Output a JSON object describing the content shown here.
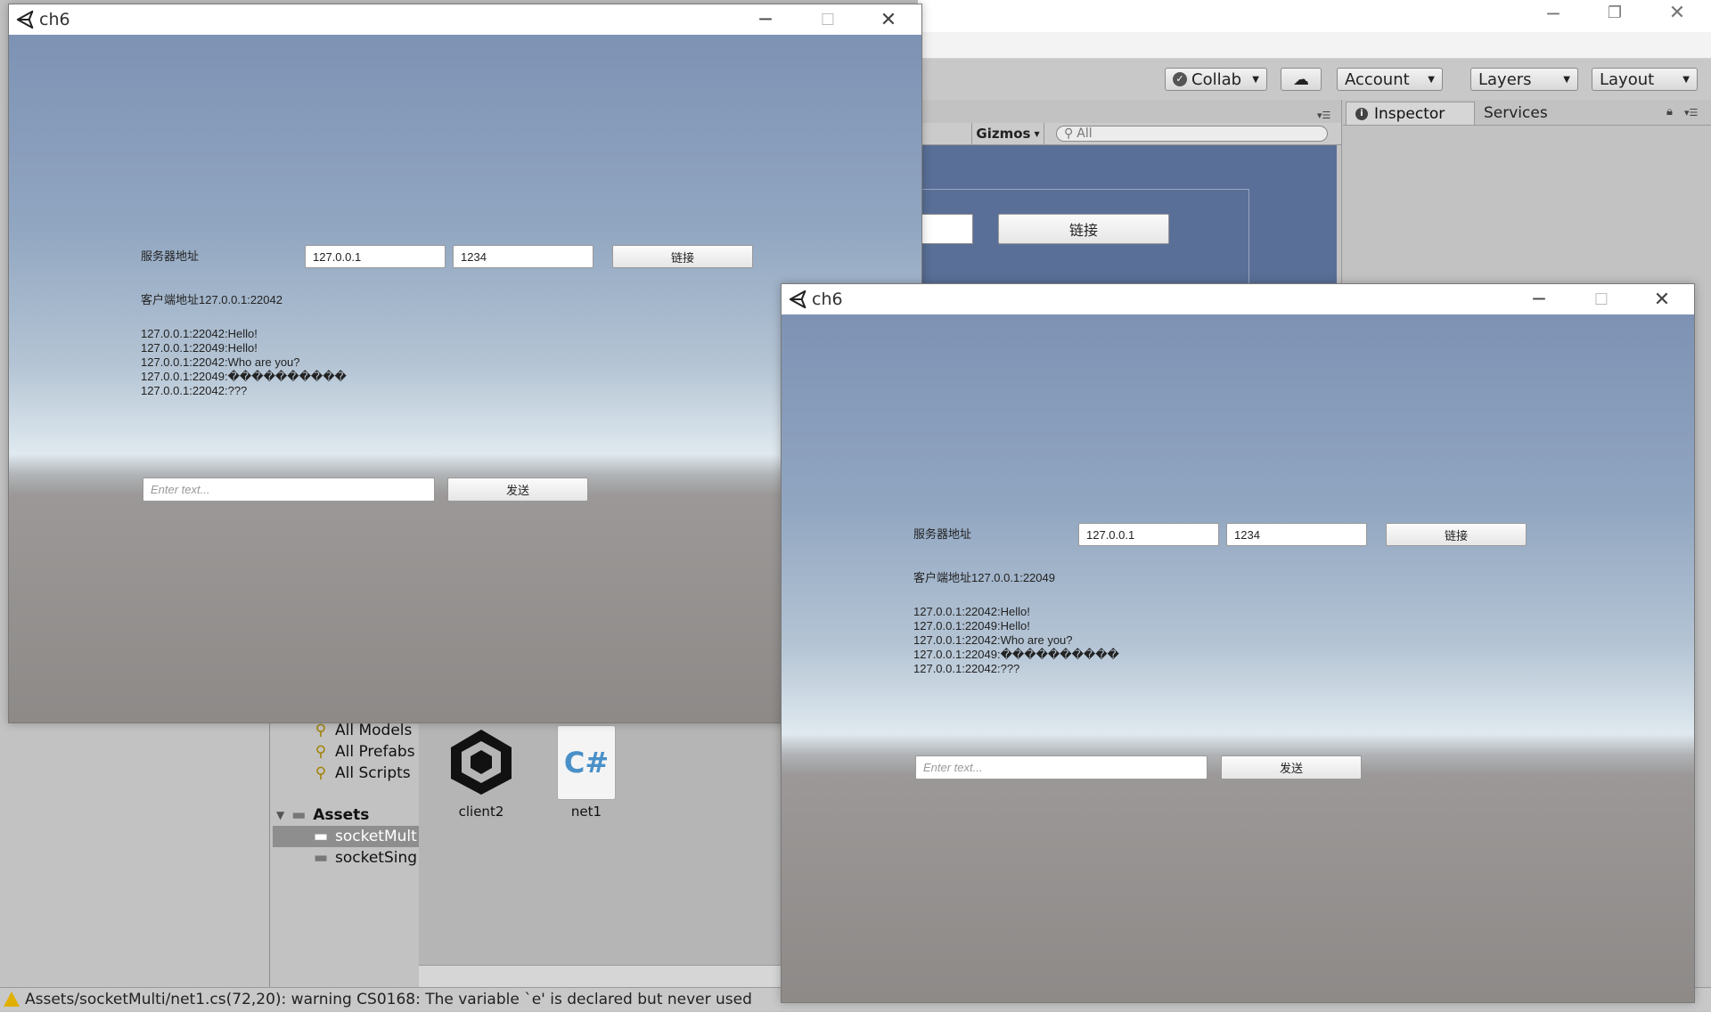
{
  "editor": {
    "toolbar": {
      "collab": "Collab",
      "account": "Account",
      "layers": "Layers",
      "layout": "Layout"
    },
    "scene": {
      "gizmos": "Gizmos",
      "search_placeholder": "All",
      "connect_button": "链接"
    },
    "tabs": {
      "inspector": "Inspector",
      "services": "Services"
    },
    "project": {
      "favorites": [
        "All Models",
        "All Prefabs",
        "All Scripts"
      ],
      "assets_root": "Assets",
      "folders": [
        "socketMult",
        "socketSing"
      ],
      "assets": [
        "client2",
        "net1"
      ]
    },
    "console_warning": "Assets/socketMulti/net1.cs(72,20): warning CS0168: The variable `e' is declared but never used"
  },
  "window1": {
    "title": "ch6",
    "server_label": "服务器地址",
    "ip_value": "127.0.0.1",
    "port_value": "1234",
    "connect_button": "链接",
    "client_address": "客户端地址127.0.0.1:22042",
    "messages": [
      "127.0.0.1:22042:Hello!",
      "127.0.0.1:22049:Hello!",
      "127.0.0.1:22042:Who are you?",
      "127.0.0.1:22049:����������",
      "127.0.0.1:22042:???"
    ],
    "input_placeholder": "Enter text...",
    "send_button": "发送"
  },
  "window2": {
    "title": "ch6",
    "server_label": "服务器地址",
    "ip_value": "127.0.0.1",
    "port_value": "1234",
    "connect_button": "链接",
    "client_address": "客户端地址127.0.0.1:22049",
    "messages": [
      "127.0.0.1:22042:Hello!",
      "127.0.0.1:22049:Hello!",
      "127.0.0.1:22042:Who are you?",
      "127.0.0.1:22049:����������",
      "127.0.0.1:22042:???"
    ],
    "input_placeholder": "Enter text...",
    "send_button": "发送"
  }
}
